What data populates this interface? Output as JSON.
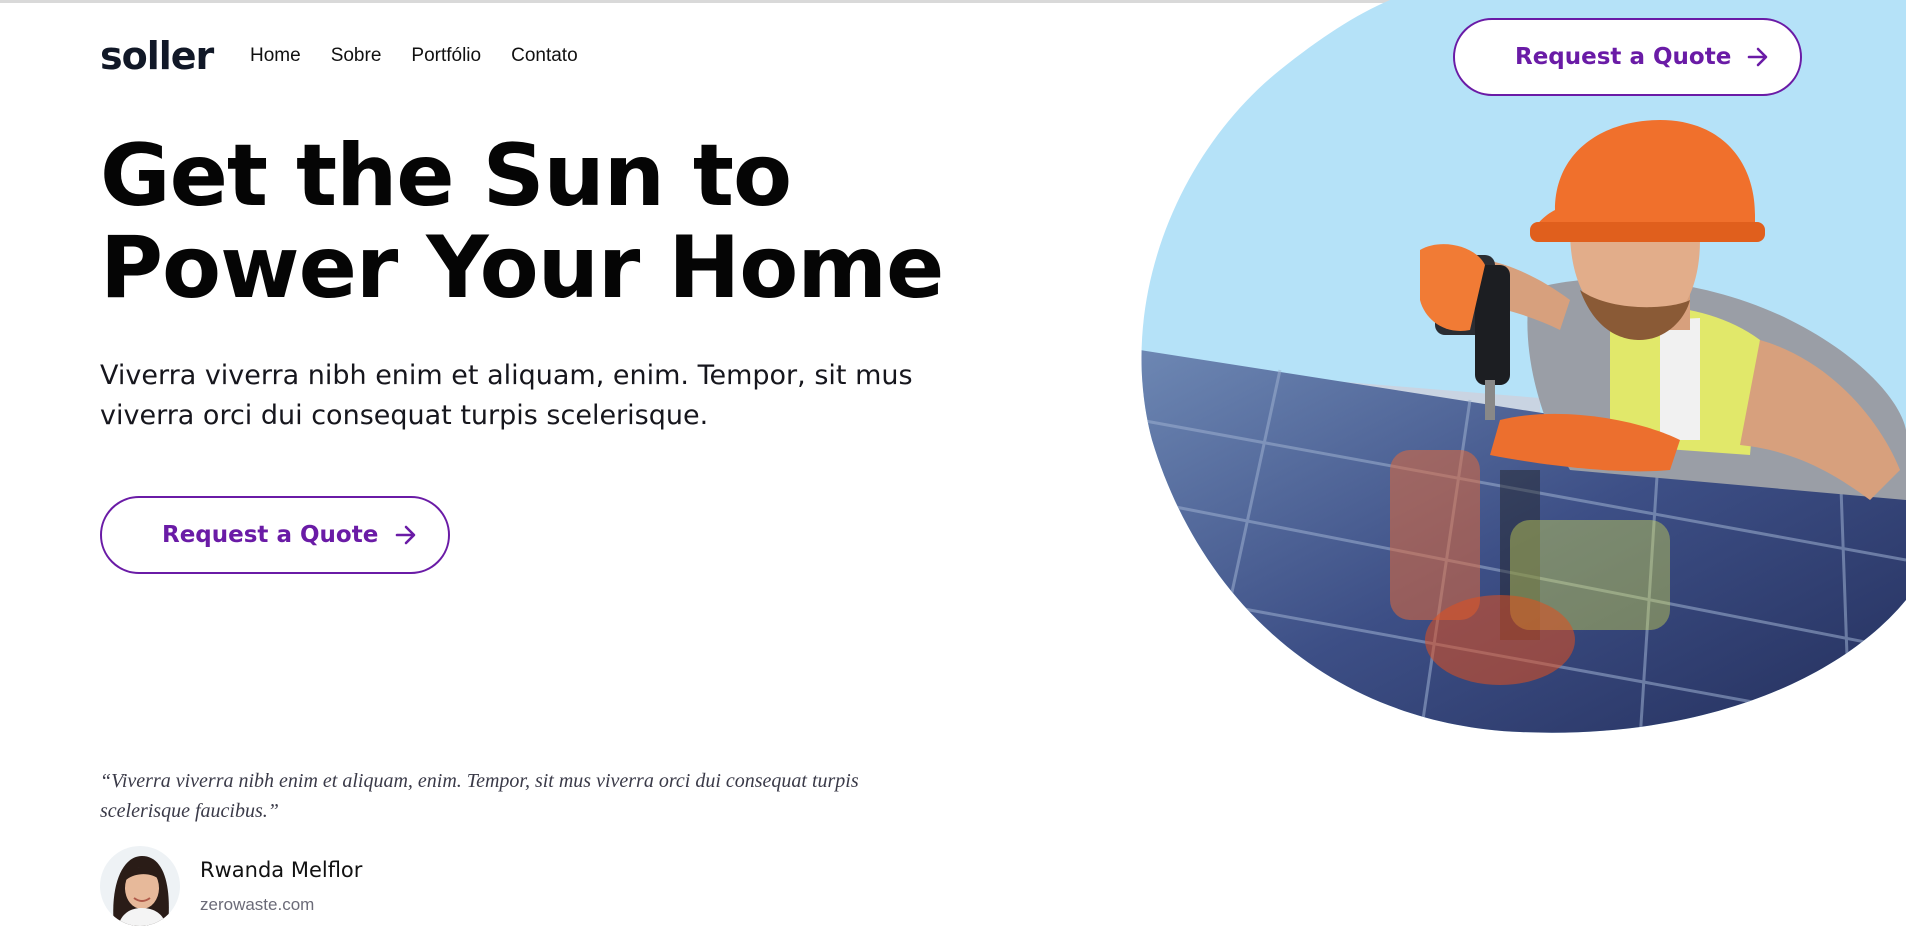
{
  "brand": {
    "logo": "soller"
  },
  "nav": {
    "items": [
      "Home",
      "Sobre",
      "Portfólio",
      "Contato"
    ]
  },
  "header": {
    "cta_label": "Request a Quote"
  },
  "hero": {
    "title_line1": "Get the Sun to",
    "title_line2": "Power Your Home",
    "subtitle": "Viverra viverra nibh enim et aliquam, enim. Tempor, sit mus viverra orci dui consequat turpis scelerisque.",
    "cta_label": "Request a Quote",
    "image_alt": "worker-installing-solar-panel-photo"
  },
  "testimonial": {
    "quote": "“Viverra viverra nibh enim et aliquam, enim. Tempor, sit mus viverra orci dui consequat turpis scelerisque faucibus.”",
    "author_name": "Rwanda Melflor",
    "author_site": "zerowaste.com"
  },
  "colors": {
    "accent": "#6a1ba6",
    "sky": "#b5e2f8",
    "helmet": "#f0702c",
    "text": "#0b0b12"
  },
  "icons": [
    "arrow-right-icon"
  ]
}
